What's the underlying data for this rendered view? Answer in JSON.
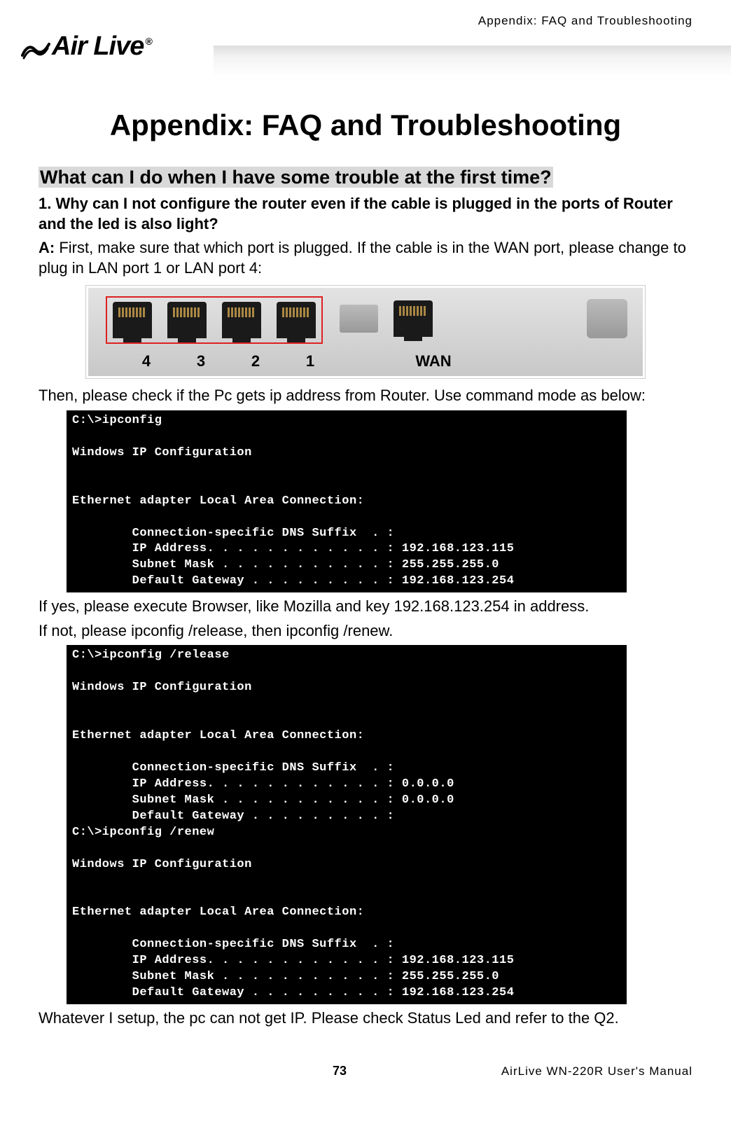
{
  "header": {
    "right_text": "Appendix: FAQ and Troubleshooting",
    "logo_text": "Air Live",
    "logo_reg": "®"
  },
  "main_title": "Appendix: FAQ and Troubleshooting",
  "section": {
    "title": "What can I do when I have some trouble at the first time?",
    "q1": "1. Why can I not configure the router even if the cable is plugged in the ports of Router and the led is also light?",
    "a1_label": "A:",
    "a1_text": " First, make sure that which port is plugged. If the cable is in the WAN port, please change to plug in LAN port 1 or LAN port 4:",
    "p2": "Then, please check if the Pc gets ip address from Router. Use command mode as below:",
    "p3": "If yes, please execute Browser, like Mozilla and key 192.168.123.254 in address.",
    "p4": "If not, please ipconfig /release, then ipconfig /renew.",
    "p5": "Whatever I setup, the pc can not get IP. Please check Status Led and refer to the Q2."
  },
  "router_ports": {
    "labels": [
      "4",
      "3",
      "2",
      "1"
    ],
    "wan_label": "WAN"
  },
  "cmd1": "C:\\>ipconfig\n\nWindows IP Configuration\n\n\nEthernet adapter Local Area Connection:\n\n        Connection-specific DNS Suffix  . :\n        IP Address. . . . . . . . . . . . : 192.168.123.115\n        Subnet Mask . . . . . . . . . . . : 255.255.255.0\n        Default Gateway . . . . . . . . . : 192.168.123.254",
  "cmd2": "C:\\>ipconfig /release\n\nWindows IP Configuration\n\n\nEthernet adapter Local Area Connection:\n\n        Connection-specific DNS Suffix  . :\n        IP Address. . . . . . . . . . . . : 0.0.0.0\n        Subnet Mask . . . . . . . . . . . : 0.0.0.0\n        Default Gateway . . . . . . . . . :\nC:\\>ipconfig /renew\n\nWindows IP Configuration\n\n\nEthernet adapter Local Area Connection:\n\n        Connection-specific DNS Suffix  . :\n        IP Address. . . . . . . . . . . . : 192.168.123.115\n        Subnet Mask . . . . . . . . . . . : 255.255.255.0\n        Default Gateway . . . . . . . . . : 192.168.123.254",
  "footer": {
    "page_number": "73",
    "right_text": "AirLive WN-220R User's Manual"
  }
}
